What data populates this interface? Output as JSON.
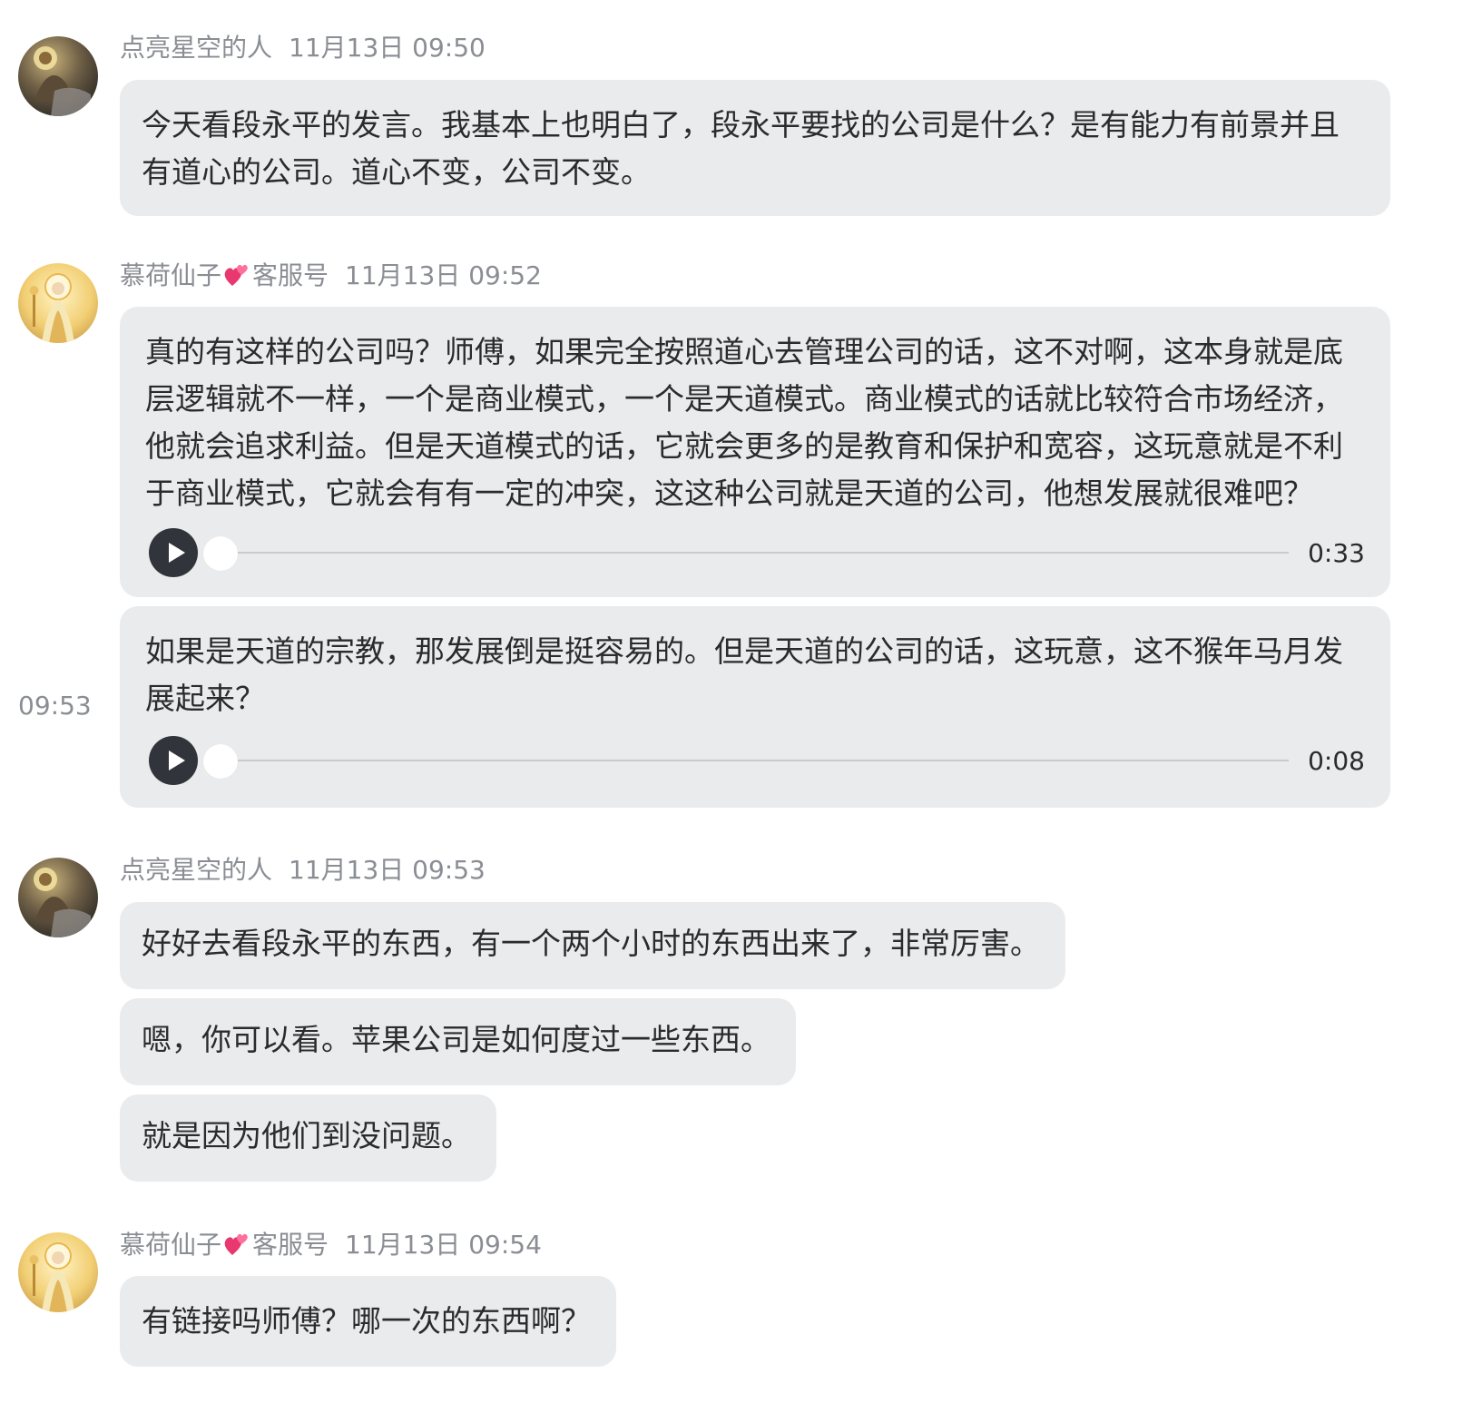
{
  "messages": [
    {
      "sender": "点亮星空的人",
      "tag": "",
      "timestamp": "11月13日 09:50",
      "bubbles": [
        {
          "text": "今天看段永平的发言。我基本上也明白了，段永平要找的公司是什么？是有能力有前景并且有道心的公司。道心不变，公司不变。"
        }
      ]
    },
    {
      "sender": "慕荷仙子",
      "tag": "客服号",
      "timestamp": "11月13日 09:52",
      "bubbles": [
        {
          "text": "真的有这样的公司吗？师傅，如果完全按照道心去管理公司的话，这不对啊，这本身就是底层逻辑就不一样，一个是商业模式，一个是天道模式。商业模式的话就比较符合市场经济，他就会追求利益。但是天道模式的话，它就会更多的是教育和保护和宽容，这玩意就是不利于商业模式，它就会有有一定的冲突，这这种公司就是天道的公司，他想发展就很难吧？",
          "audio_duration": "0:33"
        },
        {
          "text": "如果是天道的宗教，那发展倒是挺容易的。但是天道的公司的话，这玩意，这不猴年马月发展起来？",
          "audio_duration": "0:08",
          "side_time": "09:53"
        }
      ]
    },
    {
      "sender": "点亮星空的人",
      "tag": "",
      "timestamp": "11月13日 09:53",
      "bubbles": [
        {
          "text": "好好去看段永平的东西，有一个两个小时的东西出来了，非常厉害。"
        },
        {
          "text": "嗯，你可以看。苹果公司是如何度过一些东西。"
        },
        {
          "text": "就是因为他们到没问题。"
        }
      ]
    },
    {
      "sender": "慕荷仙子",
      "tag": "客服号",
      "timestamp": "11月13日 09:54",
      "bubbles": [
        {
          "text": "有链接吗师傅？哪一次的东西啊？"
        }
      ]
    }
  ],
  "icons": {
    "avatar_1": "buddha-avatar-icon",
    "avatar_2": "guanyin-avatar-icon",
    "heart": "two-hearts-icon",
    "play": "play-icon"
  },
  "colors": {
    "bubble_bg": "#eaebed",
    "meta_text": "#8a8d93",
    "play_button": "#31343a"
  }
}
